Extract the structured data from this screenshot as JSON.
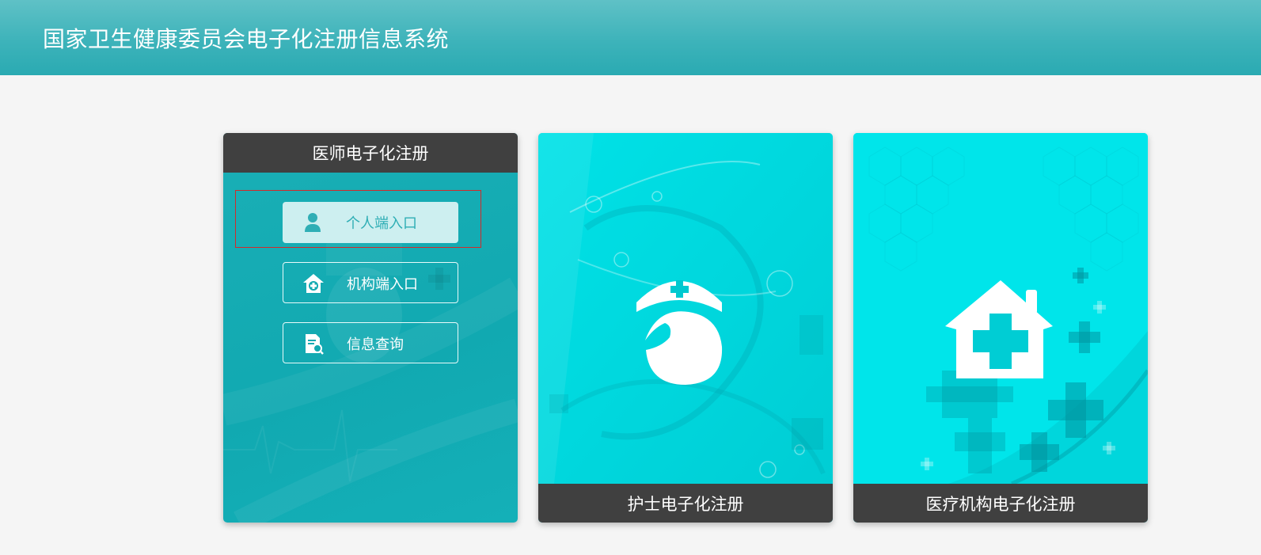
{
  "header": {
    "title": "国家卫生健康委员会电子化注册信息系统"
  },
  "cards": {
    "doctor": {
      "title": "医师电子化注册",
      "buttons": {
        "personal": {
          "label": "个人端入口",
          "icon": "user-icon"
        },
        "institution": {
          "label": "机构端入口",
          "icon": "hospital-plus-icon"
        },
        "query": {
          "label": "信息查询",
          "icon": "document-search-icon"
        }
      }
    },
    "nurse": {
      "title": "护士电子化注册",
      "icon": "nurse-cap-icon"
    },
    "hospital": {
      "title": "医疗机构电子化注册",
      "icon": "hospital-house-icon"
    }
  },
  "colors": {
    "header_bg": "#3db3ba",
    "doctor_card_bg": "#11a9b1",
    "nurse_card_bg": "#00dde2",
    "hospital_card_bg": "#00e5ea",
    "card_label_bg": "#404040",
    "selected_button_bg": "#cdeff0",
    "selected_button_text": "#2faeb5",
    "highlight_border": "#d32a2a"
  }
}
